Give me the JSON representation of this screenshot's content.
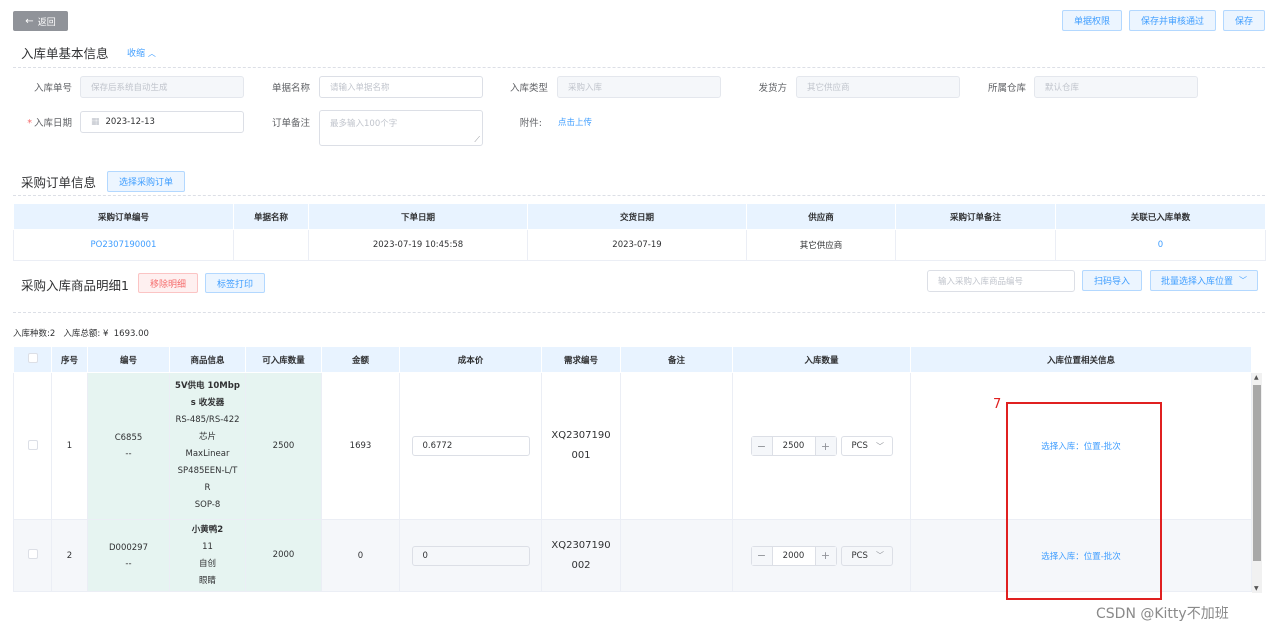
{
  "header": {
    "back_label": "返回",
    "permission_label": "单据权限",
    "save_approve_label": "保存并审核通过",
    "save_label": "保存"
  },
  "basic": {
    "title": "入库单基本信息",
    "collapse_label": "收缩",
    "order_no_label": "入库单号",
    "order_no_placeholder": "保存后系统自动生成",
    "doc_name_label": "单据名称",
    "doc_name_placeholder": "请输入单据名称",
    "type_label": "入库类型",
    "type_value": "采购入库",
    "shipper_label": "发货方",
    "shipper_value": "其它供应商",
    "warehouse_label": "所属仓库",
    "warehouse_placeholder": "默认仓库",
    "date_label": "入库日期",
    "date_value": "2023-12-13",
    "remark_label": "订单备注",
    "remark_placeholder": "最多输入100个字",
    "attach_label": "附件:",
    "upload_label": "点击上传"
  },
  "purchase": {
    "title": "采购订单信息",
    "select_label": "选择采购订单",
    "columns": [
      "采购订单编号",
      "单据名称",
      "下单日期",
      "交货日期",
      "供应商",
      "采购订单备注",
      "关联已入库单数"
    ],
    "row": {
      "order_no": "PO2307190001",
      "doc_name": "",
      "order_date": "2023-07-19 10:45:58",
      "delivery_date": "2023-07-19",
      "supplier": "其它供应商",
      "remark": "",
      "linked_count": "0"
    }
  },
  "details": {
    "title": "采购入库商品明细1",
    "remove_label": "移除明细",
    "print_label": "标签打印",
    "search_placeholder": "输入采购入库商品编号",
    "scan_label": "扫码导入",
    "batch_label": "批量选择入库位置",
    "summary": "入库种数:2   入库总额: ¥  1693.00",
    "columns": [
      "序号",
      "编号",
      "商品信息",
      "可入库数量",
      "金额",
      "成本价",
      "需求编号",
      "备注",
      "入库数量",
      "入库位置相关信息"
    ],
    "rows": [
      {
        "index": "1",
        "code": "C6855",
        "code_sub": "--",
        "goods_lines": [
          "5V供电 10Mbp",
          "s 收发器",
          "RS-485/RS-422",
          "芯片",
          "MaxLinear",
          "SP485EEN-L/T",
          "R",
          "SOP-8"
        ],
        "available_qty": "2500",
        "amount": "1693",
        "cost": "0.6772",
        "demand_lines": [
          "XQ2307190",
          "001"
        ],
        "note": "",
        "qty": "2500",
        "unit": "PCS",
        "location_link": "选择入库：位置-批次"
      },
      {
        "index": "2",
        "code": "D000297",
        "code_sub": "--",
        "goods_lines": [
          "小黄鸭2",
          "11",
          "自创",
          "眼睛"
        ],
        "available_qty": "2000",
        "amount": "0",
        "cost": "0",
        "demand_lines": [
          "XQ2307190",
          "002"
        ],
        "note": "",
        "qty": "2000",
        "unit": "PCS",
        "location_link": "选择入库：位置-批次"
      }
    ]
  },
  "annotation": {
    "number": "7",
    "color": "#e02020"
  },
  "watermark": "CSDN @Kitty不加班"
}
